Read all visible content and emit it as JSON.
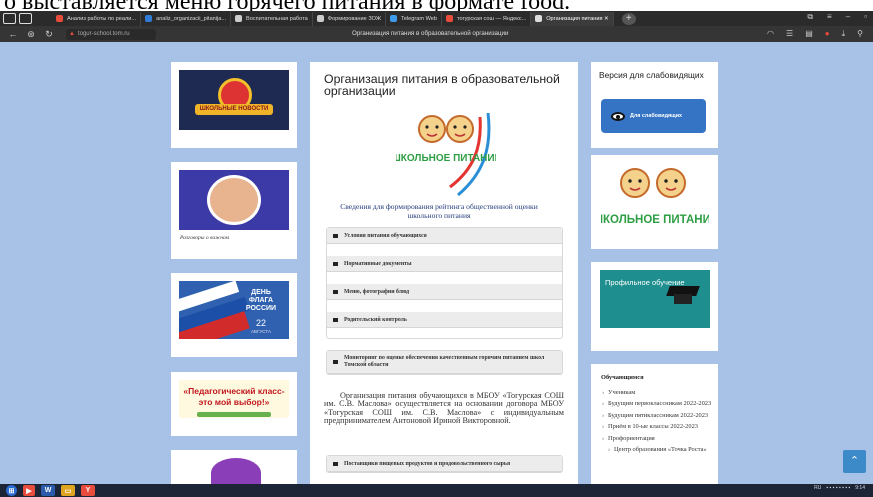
{
  "caption": "о выставляется меню горячего питания в формате food.",
  "browser": {
    "tabs": [
      {
        "label": "Анализ работы по реали...",
        "color": "#e74c3c"
      },
      {
        "label": "analiz_organizacii_pitanija...",
        "color": "#2f7bd6"
      },
      {
        "label": "Воспитательная работа",
        "color": "#cccccc"
      },
      {
        "label": "Формирование ЗОЖ",
        "color": "#cccccc"
      },
      {
        "label": "Telegram Web",
        "color": "#3d9be9"
      },
      {
        "label": "тогурская сош — Яндекс...",
        "color": "#e74c3c"
      },
      {
        "label": "Организация питания ✕",
        "color": "#dddddd"
      }
    ],
    "url": "togur-school.tom.ru",
    "page_title": "Организация питания в образовательной организации"
  },
  "left": {
    "news_label": "ШКОЛЬНЫЕ НОВОСТИ",
    "rasg_caption": "Разговоры о важном",
    "flag_title": "ДЕНЬ ФЛАГА РОССИИ",
    "flag_day": "22",
    "flag_month": "АВГУСТА",
    "ped_text": "«Педагогический класс- это мой выбор!»"
  },
  "main": {
    "title": "Организация питания в образовательной организации",
    "logo_text": "ШКОЛЬНОЕ ПИТАНИЕ",
    "svedeniya": "Сведения для формирования рейтинга общественной оценки школьного питания",
    "accordion": [
      "Условия питания обучающихся",
      "Нормативные документы",
      "Меню, фотографии блюд",
      "Родительский контроль"
    ],
    "monitoring": "Мониторинг по оценке обеспечения качественным горячим питанием школ Томской области",
    "intro": "Организация питания обучающихся в МБОУ «Тогурская СОШ им. С.В. Маслова» осуществляется на основании договора МБОУ «Тогурская СОШ им. С.В. Маслова» с индивидуальным предпринимателем Антоновой Ириной Викторовной.",
    "suppliers": "Поставщики пищевых продуктов и продовольственного сырья"
  },
  "right": {
    "vision_title": "Версия для слабовидящих",
    "vision_button": "Для слабовидящих",
    "logo_text": "ШКОЛЬНОЕ ПИТАНИЕ",
    "prof_text": "Профильное обучение",
    "students_title": "Обучающимся",
    "students_links": [
      "Ученикам",
      "Будущим первоклассникам 2022-2023",
      "Будущим пятиклассникам 2022-2023",
      "Приём в 10-ые классы 2022-2023",
      "Профориентация"
    ],
    "students_sublink": "Центр образования «Точка Роста»"
  },
  "taskbar": {
    "clock": "9:14",
    "lang": "RU"
  }
}
